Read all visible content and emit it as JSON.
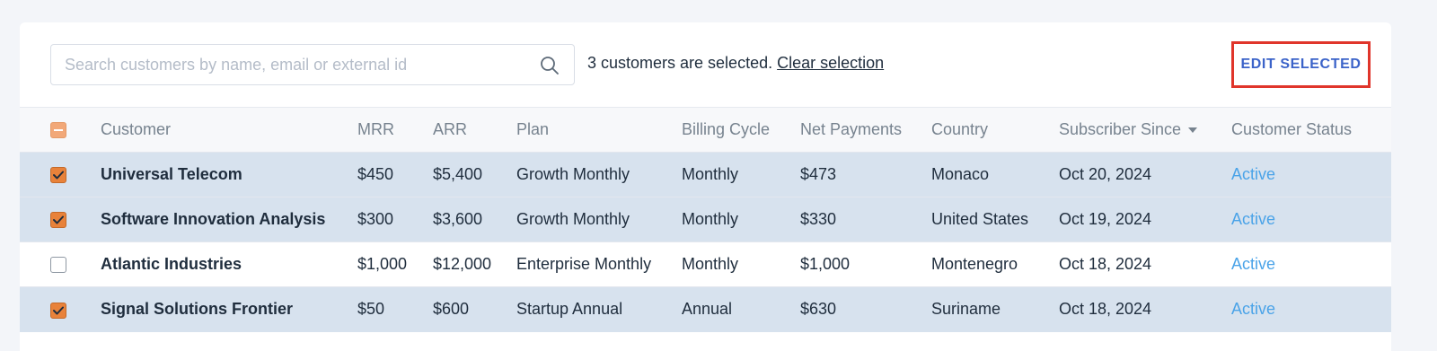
{
  "search": {
    "placeholder": "Search customers by name, email or external id",
    "value": "",
    "icon": "search-icon"
  },
  "selection": {
    "message": "3 customers are selected.",
    "clear_label": "Clear selection"
  },
  "actions": {
    "edit_selected_label": "EDIT SELECTED"
  },
  "table": {
    "header_checkbox_state": "indeterminate",
    "columns": {
      "customer": "Customer",
      "mrr": "MRR",
      "arr": "ARR",
      "plan": "Plan",
      "billing_cycle": "Billing Cycle",
      "net_payments": "Net Payments",
      "country": "Country",
      "subscriber_since": "Subscriber Since",
      "customer_status": "Customer Status"
    },
    "sort": {
      "column": "subscriber_since",
      "direction": "descending"
    },
    "rows": [
      {
        "selected": true,
        "customer": "Universal Telecom",
        "mrr": "$450",
        "arr": "$5,400",
        "plan": "Growth Monthly",
        "billing_cycle": "Monthly",
        "net_payments": "$473",
        "country": "Monaco",
        "subscriber_since": "Oct 20, 2024",
        "status": "Active"
      },
      {
        "selected": true,
        "customer": "Software Innovation Analysis",
        "mrr": "$300",
        "arr": "$3,600",
        "plan": "Growth Monthly",
        "billing_cycle": "Monthly",
        "net_payments": "$330",
        "country": "United States",
        "subscriber_since": "Oct 19, 2024",
        "status": "Active"
      },
      {
        "selected": false,
        "customer": "Atlantic Industries",
        "mrr": "$1,000",
        "arr": "$12,000",
        "plan": "Enterprise Monthly",
        "billing_cycle": "Monthly",
        "net_payments": "$1,000",
        "country": "Montenegro",
        "subscriber_since": "Oct 18, 2024",
        "status": "Active"
      },
      {
        "selected": true,
        "customer": "Signal Solutions Frontier",
        "mrr": "$50",
        "arr": "$600",
        "plan": "Startup Annual",
        "billing_cycle": "Annual",
        "net_payments": "$630",
        "country": "Suriname",
        "subscriber_since": "Oct 18, 2024",
        "status": "Active"
      }
    ]
  },
  "colors": {
    "accent_checkbox": "#e8823a",
    "selected_row": "#d7e2ee",
    "status_active": "#4aa3e8",
    "edit_button_text": "#3b63c9",
    "edit_button_border": "#e0352b"
  }
}
